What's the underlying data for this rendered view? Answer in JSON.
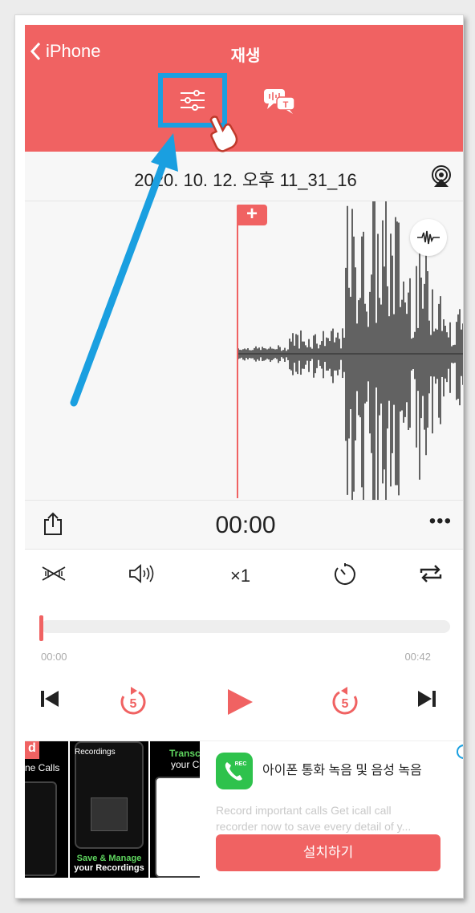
{
  "header": {
    "back_label": "iPhone",
    "title": "재생"
  },
  "recording": {
    "date": "2020. 10. 12. 오후 11_31_16"
  },
  "waveform": {
    "add_marker": "+"
  },
  "time": {
    "current": "00:00",
    "more": "•••"
  },
  "controls": {
    "speed": "×1"
  },
  "progress": {
    "start": "00:00",
    "end": "00:42",
    "fraction": 0
  },
  "transport": {
    "skip_back": "5",
    "skip_forward": "5"
  },
  "ad": {
    "shot1_title": "d",
    "shot1_sub": "ne Calls",
    "shot2_header": "Recordings",
    "shot2_caption1": "Save & Manage",
    "shot2_caption2": "your Recordings",
    "shot3_title": "Transcrib",
    "shot3_sub": "your Cal",
    "app_icon_label": "REC",
    "title": "아이폰 통화 녹음 및 음성 녹음",
    "description_line1": "Record important calls Get icall call",
    "description_line2": "recorder now to save every detail of y...",
    "install_label": "설치하기",
    "info_label": "i"
  },
  "colors": {
    "accent": "#f06262",
    "highlight": "#1a9fe0",
    "waveform": "#3c3c3c"
  }
}
